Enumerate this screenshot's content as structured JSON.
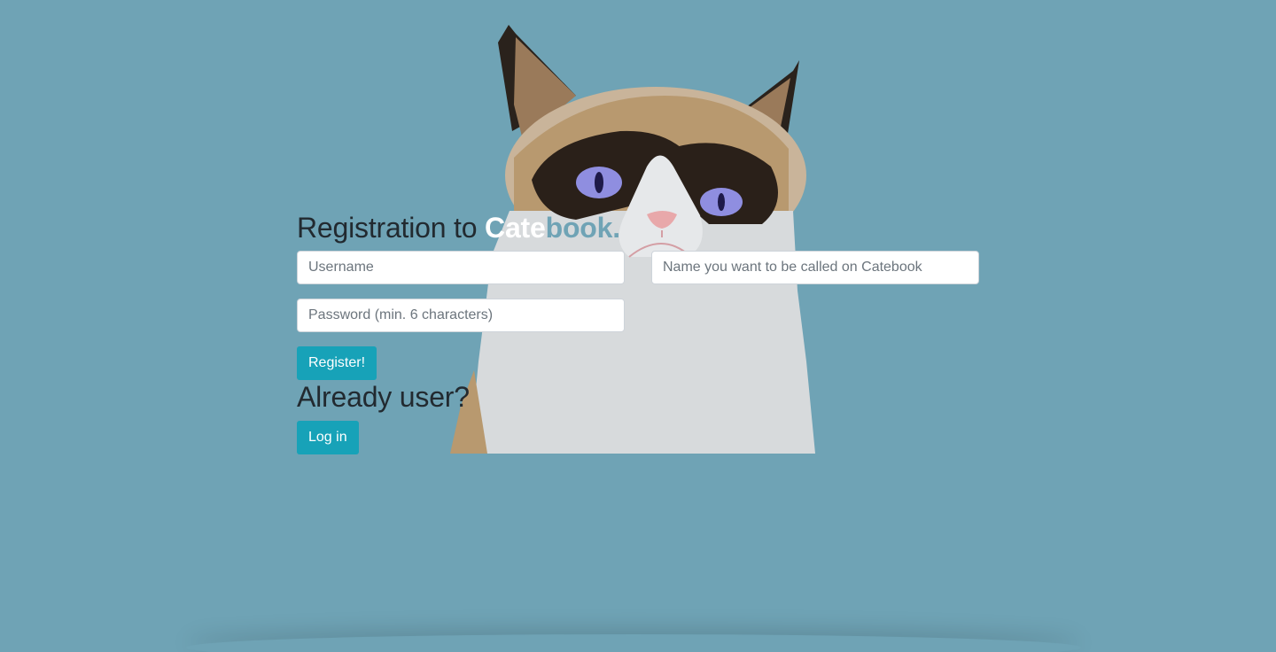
{
  "header": {
    "title_prefix": "Registration to ",
    "brand_part1": "Cate",
    "brand_part2": "book."
  },
  "form": {
    "username_placeholder": "Username",
    "display_name_placeholder": "Name you want to be called on Catebook",
    "password_placeholder": "Password (min. 6 characters)",
    "register_label": "Register!"
  },
  "login": {
    "heading": "Already user?",
    "login_label": "Log in"
  },
  "theme": {
    "background": "#6fa3b5",
    "button": "#17a2b8",
    "brand_white": "#ffffff"
  },
  "hero_image": "grumpy-cat-illustration"
}
